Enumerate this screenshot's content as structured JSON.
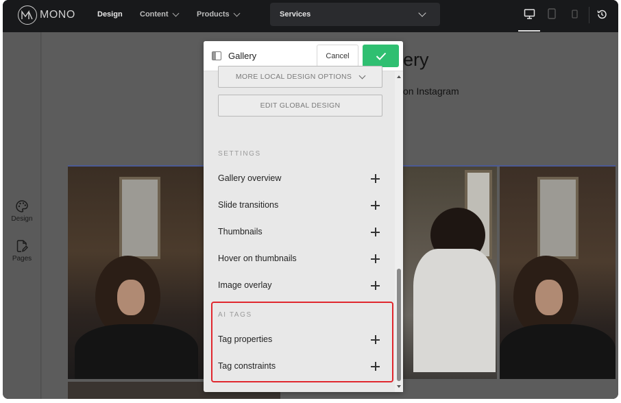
{
  "topbar": {
    "logo_text": "MONO",
    "nav": [
      {
        "label": "Design",
        "active": true
      },
      {
        "label": "Content",
        "dropdown": true
      },
      {
        "label": "Products",
        "dropdown": true
      }
    ],
    "page_select": "Services",
    "devices": [
      "desktop-icon",
      "tablet-icon",
      "mobile-icon"
    ],
    "history_icon": "history-icon"
  },
  "sidebar": {
    "items": [
      {
        "label": "Design",
        "icon": "palette-icon"
      },
      {
        "label": "Pages",
        "icon": "page-edit-icon"
      }
    ]
  },
  "canvas": {
    "heading_peek": "ery",
    "subheading_peek": "on Instagram"
  },
  "panel": {
    "title": "Gallery",
    "cancel_label": "Cancel",
    "confirm_icon": "check-icon",
    "more_local_design": "MORE LOCAL DESIGN OPTIONS",
    "edit_global_design": "EDIT GLOBAL DESIGN",
    "settings_label": "SETTINGS",
    "settings_items": [
      "Gallery overview",
      "Slide transitions",
      "Thumbnails",
      "Hover on thumbnails",
      "Image overlay"
    ],
    "ai_tags_label": "AI TAGS",
    "ai_tags_items": [
      "Tag properties",
      "Tag constraints"
    ]
  },
  "colors": {
    "topbar_bg": "#18191b",
    "confirm_green": "#2fbf71",
    "highlight_red": "#e0262d",
    "selection_blue": "#4b5a95"
  }
}
